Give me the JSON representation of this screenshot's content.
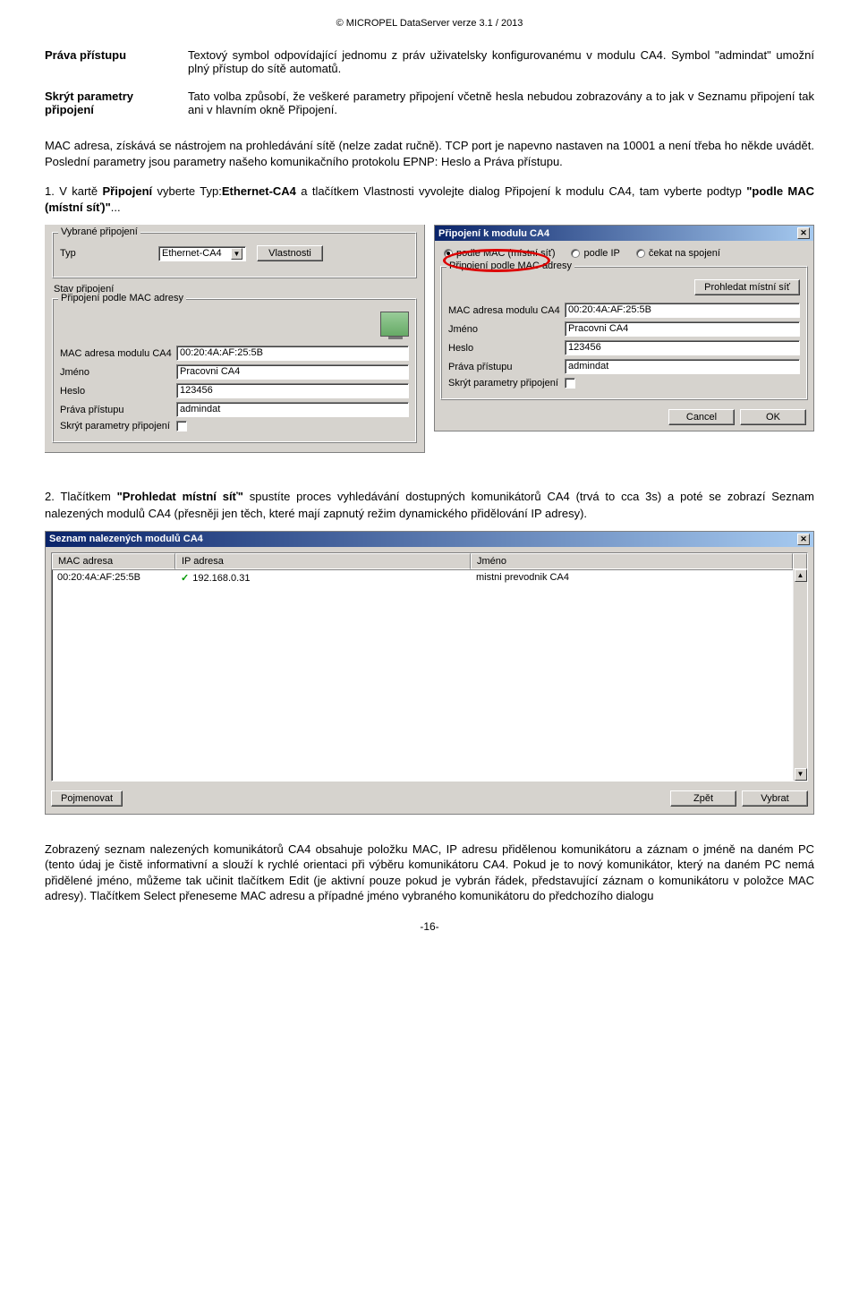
{
  "header": "© MICROPEL DataServer verze 3.1 / 2013",
  "defs": [
    {
      "term": "Práva přístupu",
      "desc": "Textový symbol odpovídající jednomu z práv uživatelsky konfigurovanému v modulu CA4. Symbol \"admindat\" umožní plný přístup do sítě automatů."
    },
    {
      "term": "Skrýt parametry připojení",
      "desc": "Tato volba způsobí, že veškeré parametry připojení včetně hesla nebudou zobrazovány a to jak v Seznamu připojení tak ani v hlavním okně Připojení."
    }
  ],
  "para1": "MAC adresa, získává se nástrojem na prohledávání sítě (nelze zadat ručně). TCP port je napevno nastaven na 10001 a není třeba ho někde uvádět. Poslední parametry jsou parametry našeho komunikačního protokolu EPNP: Heslo a Práva přístupu.",
  "step1_prefix": "1. V kartě ",
  "step1_b1": "Připojení",
  "step1_mid1": " vyberte Typ:",
  "step1_b2": "Ethernet-CA4",
  "step1_mid2": " a tlačítkem Vlastnosti vyvolejte dialog Připojení k modulu CA4, tam vyberte podtyp ",
  "step1_b3": "\"podle MAC (místní síť)\"",
  "step1_suffix": "...",
  "panelA": {
    "fs1": "Vybrané připojení",
    "lbl_typ": "Typ",
    "typ_val": "Ethernet-CA4",
    "btn_vlast": "Vlastnosti",
    "fs2": "Stav připojení",
    "fs3": "Připojení podle MAC adresy",
    "lbl_mac": "MAC adresa modulu CA4",
    "mac_val": "00:20:4A:AF:25:5B",
    "lbl_jmeno": "Jméno",
    "jmeno_val": "Pracovni CA4",
    "lbl_heslo": "Heslo",
    "heslo_val": "123456",
    "lbl_prava": "Práva přístupu",
    "prava_val": "admindat",
    "lbl_skryt": "Skrýt parametry připojení"
  },
  "panelB": {
    "title": "Připojení k modulu CA4",
    "radio1": "podle MAC (místní síť)",
    "radio2": "podle IP",
    "radio3": "čekat na spojení",
    "fs": "Připojení podle MAC adresy",
    "btn_scan": "Prohledat místní síť",
    "lbl_mac": "MAC adresa modulu CA4",
    "mac_val": "00:20:4A:AF:25:5B",
    "lbl_jmeno": "Jméno",
    "jmeno_val": "Pracovni CA4",
    "lbl_heslo": "Heslo",
    "heslo_val": "123456",
    "lbl_prava": "Práva přístupu",
    "prava_val": "admindat",
    "lbl_skryt": "Skrýt parametry připojení",
    "btn_cancel": "Cancel",
    "btn_ok": "OK"
  },
  "step2_prefix": "2. Tlačítkem ",
  "step2_b": "\"Prohledat místní síť\"",
  "step2_rest": " spustíte proces vyhledávání dostupných komunikátorů CA4 (trvá to cca 3s) a poté se zobrazí Seznam nalezených modulů CA4 (přesněji jen těch, které mají zapnutý režim dynamického přidělování IP adresy).",
  "listWin": {
    "title": "Seznam nalezených modulů CA4",
    "col_mac": "MAC adresa",
    "col_ip": "IP adresa",
    "col_name": "Jméno",
    "row": {
      "mac": "00:20:4A:AF:25:5B",
      "ip": "192.168.0.31",
      "name": "mistni prevodnik CA4"
    },
    "btn_rename": "Pojmenovat",
    "btn_back": "Zpět",
    "btn_select": "Vybrat"
  },
  "para2": "Zobrazený seznam nalezených komunikátorů CA4 obsahuje položku MAC, IP adresu přidělenou komunikátoru a záznam o jméně na daném PC (tento údaj je čistě informativní a slouží k rychlé orientaci při výběru komunikátoru CA4. Pokud je to nový komunikátor, který na daném PC nemá přidělené jméno, můžeme tak učinit tlačítkem Edit (je aktivní pouze pokud je vybrán řádek, představující záznam o komunikátoru v položce MAC adresy). Tlačítkem Select přeneseme MAC adresu a případné jméno vybraného komunikátoru do předchozího dialogu",
  "page_number": "-16-"
}
